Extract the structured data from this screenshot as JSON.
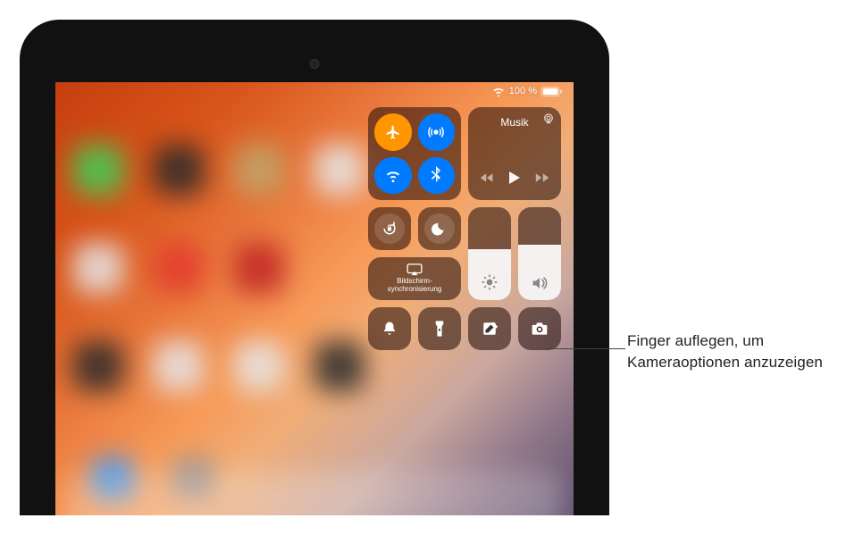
{
  "status": {
    "battery_text": "100 %"
  },
  "control_center": {
    "music": {
      "title": "Musik"
    },
    "mirroring_label": "Bildschirm-\nsynchronisierung",
    "brightness_pct": 55,
    "volume_pct": 60
  },
  "icons": {
    "wifi": "wifi-icon",
    "battery": "battery-icon",
    "airplane": "airplane-icon",
    "airdrop": "airdrop-icon",
    "bluetooth": "bluetooth-icon",
    "airplay": "airplay-icon",
    "rewind": "rewind-icon",
    "play": "play-icon",
    "forward": "forward-icon",
    "rotation_lock": "rotation-lock-icon",
    "dnd": "moon-icon",
    "screen_mirroring": "screen-mirroring-icon",
    "brightness": "brightness-icon",
    "volume": "volume-icon",
    "bell": "bell-icon",
    "flashlight": "flashlight-icon",
    "note": "note-icon",
    "camera": "camera-icon"
  },
  "callout": {
    "text": "Finger auflegen, um Kameraoptionen anzuzeigen"
  }
}
